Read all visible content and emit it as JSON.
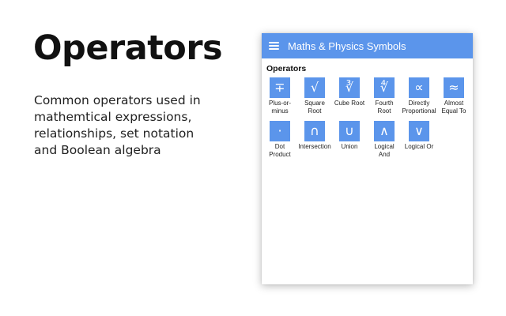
{
  "promo": {
    "title": "Operators",
    "description": "Common operators used in\nmathemtical expressions,\nrelationships, set notation\nand Boolean algebra"
  },
  "app": {
    "title": "Maths & Physics Symbols",
    "accent_color": "#5b95eb",
    "section_title": "Operators",
    "symbols": [
      {
        "glyph": "∓",
        "label": "Plus-or-\nminus"
      },
      {
        "glyph": "√",
        "label": "Square\nRoot"
      },
      {
        "glyph": "∛",
        "label": "Cube Root"
      },
      {
        "glyph": "∜",
        "label": "Fourth\nRoot"
      },
      {
        "glyph": "∝",
        "label": "Directly\nProportional"
      },
      {
        "glyph": "≈",
        "label": "Almost\nEqual To"
      },
      {
        "glyph": "·",
        "label": "Dot\nProduct"
      },
      {
        "glyph": "∩",
        "label": "Intersection"
      },
      {
        "glyph": "∪",
        "label": "Union"
      },
      {
        "glyph": "∧",
        "label": "Logical\nAnd"
      },
      {
        "glyph": "∨",
        "label": "Logical Or"
      }
    ]
  }
}
